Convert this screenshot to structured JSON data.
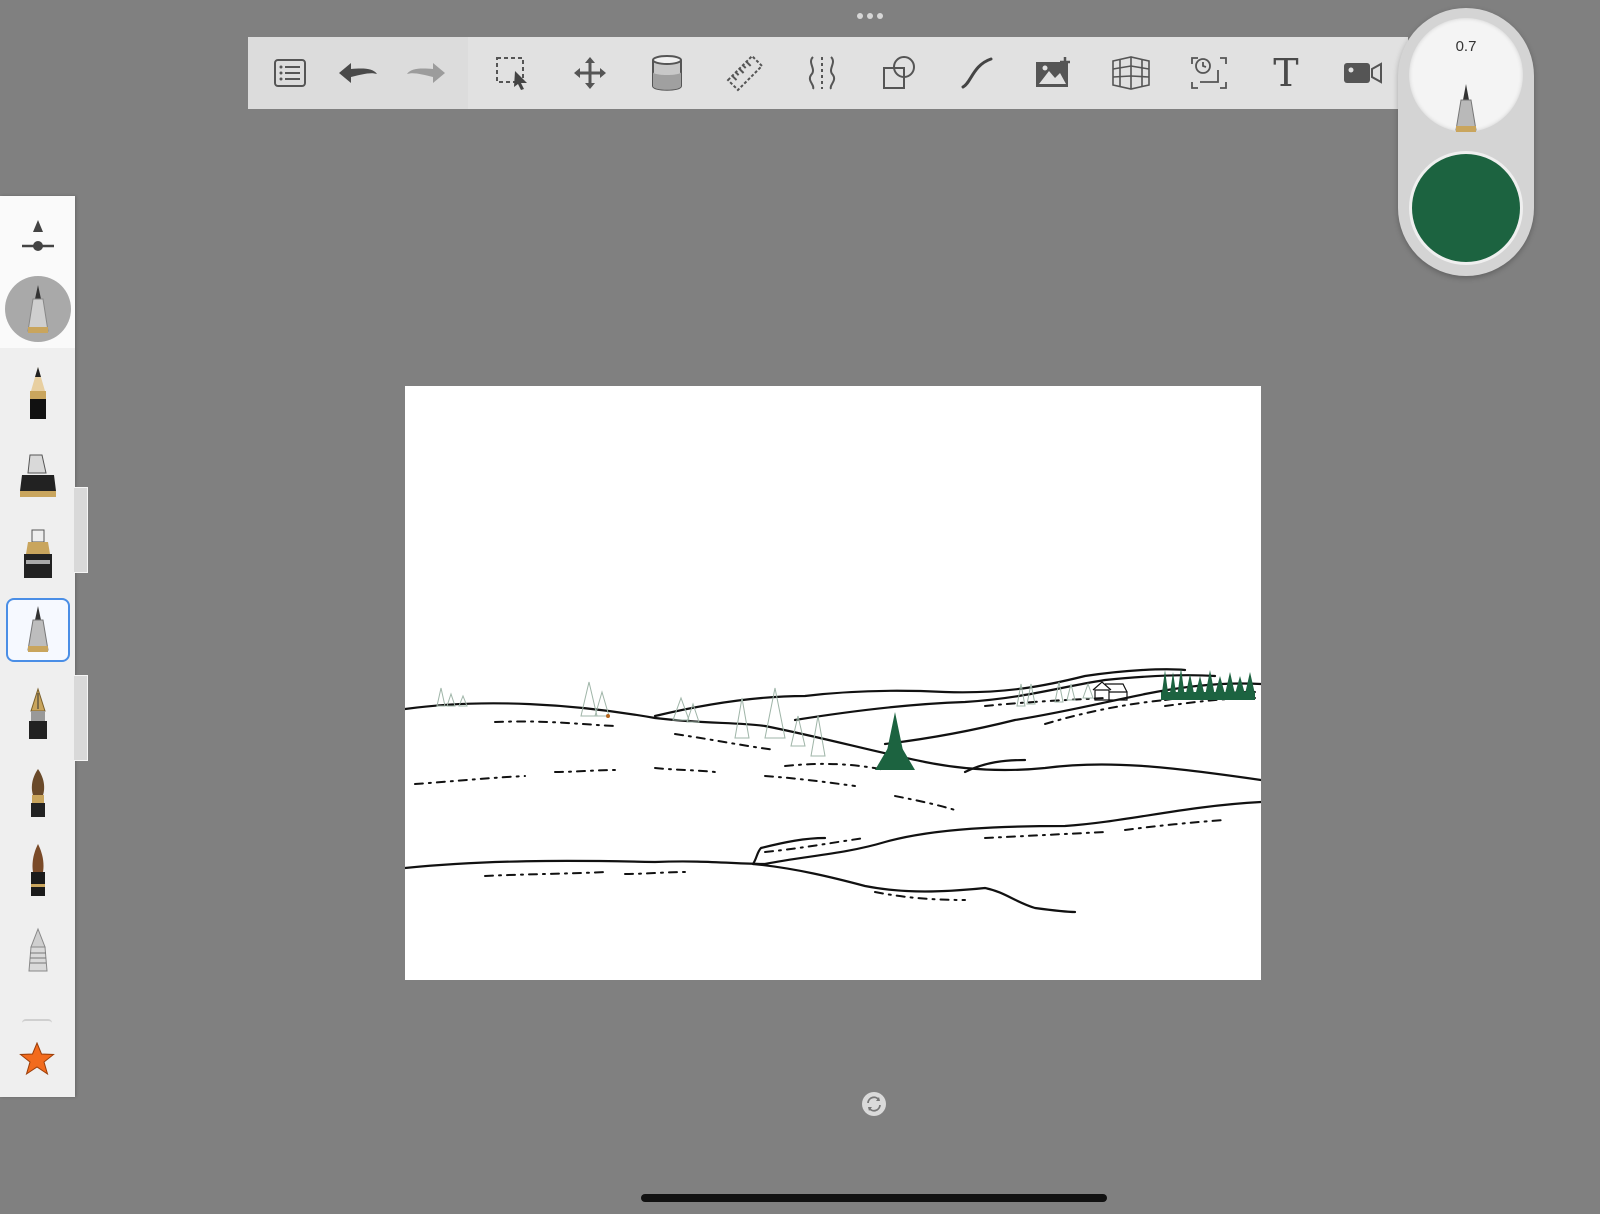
{
  "toolbar": {
    "items": [
      {
        "name": "list-menu-icon"
      },
      {
        "name": "undo-icon"
      },
      {
        "name": "redo-icon"
      },
      {
        "name": "selection-icon"
      },
      {
        "name": "move-transform-icon"
      },
      {
        "name": "fill-bucket-icon"
      },
      {
        "name": "ruler-icon"
      },
      {
        "name": "symmetry-icon"
      },
      {
        "name": "shapes-icon"
      },
      {
        "name": "curve-icon"
      },
      {
        "name": "add-image-icon"
      },
      {
        "name": "perspective-guide-icon"
      },
      {
        "name": "timelapse-icon"
      },
      {
        "name": "text-icon",
        "label": "T"
      },
      {
        "name": "video-record-icon"
      }
    ]
  },
  "brush_puck": {
    "size_value": "0.7",
    "color": "#1c6340"
  },
  "brush_panel": {
    "brushes": [
      {
        "name": "pencil-brush"
      },
      {
        "name": "marker-brush"
      },
      {
        "name": "paint-marker-brush"
      },
      {
        "name": "ballpoint-pen-brush"
      },
      {
        "name": "fountain-pen-brush"
      },
      {
        "name": "paintbrush-brush"
      },
      {
        "name": "ink-brush-brush"
      },
      {
        "name": "airbrush-brush"
      }
    ],
    "selected_index": 3,
    "favorites_icon": "star-icon",
    "accent_color": "#f26b1d"
  },
  "canvas": {
    "background": "#ffffff",
    "ink_color": "#111111",
    "tree_color": "#1c6340"
  }
}
